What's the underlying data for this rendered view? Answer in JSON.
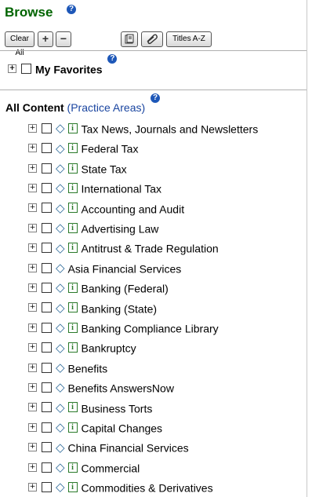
{
  "browse": {
    "title": "Browse",
    "help": "?"
  },
  "toolbar": {
    "clear_all": "Clear All",
    "expand_symbol": "+",
    "collapse_symbol": "−",
    "titles": "Titles A-Z"
  },
  "favorites": {
    "label": "My Favorites",
    "help": "?"
  },
  "all_content": {
    "label": "All Content",
    "open_paren": "(",
    "link": "Practice Areas",
    "close_paren": ")",
    "help": "?"
  },
  "icons": {
    "expand": "⊞",
    "diamond": "◇",
    "info": "i"
  },
  "items": [
    {
      "label": "Tax News, Journals and Newsletters",
      "info": true
    },
    {
      "label": "Federal Tax",
      "info": true
    },
    {
      "label": "State Tax",
      "info": true
    },
    {
      "label": "International Tax",
      "info": true
    },
    {
      "label": "Accounting and Audit",
      "info": true
    },
    {
      "label": "Advertising Law",
      "info": true
    },
    {
      "label": "Antitrust & Trade Regulation",
      "info": true
    },
    {
      "label": "Asia Financial Services",
      "info": false
    },
    {
      "label": "Banking (Federal)",
      "info": true
    },
    {
      "label": "Banking (State)",
      "info": true
    },
    {
      "label": "Banking Compliance Library",
      "info": true
    },
    {
      "label": "Bankruptcy",
      "info": true
    },
    {
      "label": "Benefits",
      "info": false
    },
    {
      "label": "Benefits AnswersNow",
      "info": false
    },
    {
      "label": "Business Torts",
      "info": true
    },
    {
      "label": "Capital Changes",
      "info": true
    },
    {
      "label": "China Financial Services",
      "info": false
    },
    {
      "label": "Commercial",
      "info": true
    },
    {
      "label": "Commodities & Derivatives",
      "info": true
    }
  ]
}
